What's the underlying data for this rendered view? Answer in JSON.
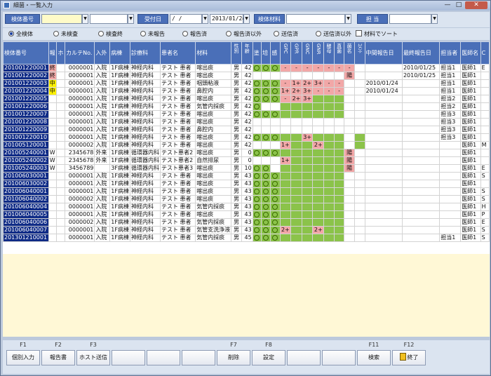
{
  "window": {
    "title": "細菌・一覧入力",
    "min": "—",
    "max": "□",
    "close": "✕"
  },
  "search": {
    "specimen_no_label": "検体番号",
    "specimen_no_value": "",
    "specimen_no_value2": "",
    "receipt_date_label": "受付日",
    "receipt_date_from": " /  / ",
    "receipt_date_to": "2013/01/24",
    "material_label": "検体材料",
    "material_value": "",
    "staff_label": "担  当",
    "staff_value": ""
  },
  "filters": {
    "options": [
      "全検体",
      "未検査",
      "検査終",
      "未報告",
      "報告済",
      "報告済以外",
      "送信済",
      "送信済以外"
    ],
    "selected": "全検体",
    "sort_checkbox_label": "材料でソート"
  },
  "table": {
    "headers": [
      "検体番号",
      "報",
      "ホ",
      "カルテNo.",
      "入外",
      "病棟",
      "診療科",
      "患者名",
      "材料",
      "性別",
      "年齢",
      "塗",
      "培",
      "感",
      "GPC",
      "GPR",
      "GNC",
      "GNR",
      "酵母",
      "真菌",
      "菌名",
      "ｺﾒﾝﾄ",
      "中間報告日",
      "最終報告日",
      "担当者",
      "医師名",
      "C"
    ],
    "rows": [
      {
        "id": "201001220001",
        "ho": "終",
        "hoc": "pk",
        "h2": "",
        "karte": "0000001",
        "io": "入院",
        "ward": "1F病棟",
        "dept": "神経内科",
        "patient": "テスト 患者",
        "material": "喀出痰",
        "sex": "男",
        "age": "42",
        "nuri": "o",
        "bai": "o",
        "kan": "o",
        "m": [
          "pk",
          "pk",
          "pk",
          "pk",
          "pk",
          "pk",
          "pk",
          "w"
        ],
        "mt": [
          "-",
          "-",
          "-",
          "-",
          "-",
          "-",
          "-",
          ""
        ],
        "mid": "",
        "fin": "2010/01/25",
        "staff": "担当1",
        "doctor": "医師1",
        "c": "E"
      },
      {
        "id": "201001220002",
        "ho": "終",
        "hoc": "pk",
        "h2": "",
        "karte": "0000001",
        "io": "入院",
        "ward": "1F病棟",
        "dept": "神経内科",
        "patient": "テスト 患者",
        "material": "喀出痰",
        "sex": "男",
        "age": "42",
        "nuri": "",
        "bai": "",
        "kan": "",
        "m": [
          "w",
          "w",
          "w",
          "w",
          "w",
          "w",
          "pk",
          "w"
        ],
        "mt": [
          "",
          "",
          "",
          "",
          "",
          "",
          "陽",
          ""
        ],
        "mid": "",
        "fin": "2010/01/25",
        "staff": "担当1",
        "doctor": "医師1",
        "c": ""
      },
      {
        "id": "201001220003",
        "ho": "中",
        "hoc": "yl",
        "h2": "",
        "karte": "0000001",
        "io": "入院",
        "ward": "1F病棟",
        "dept": "神経内科",
        "patient": "テスト 患者",
        "material": "咽頭粘液",
        "sex": "男",
        "age": "42",
        "nuri": "o",
        "bai": "o",
        "kan": "o",
        "m": [
          "pk",
          "pk",
          "pk",
          "pk",
          "pk",
          "pk",
          "w",
          "w"
        ],
        "mt": [
          "-",
          "1+",
          "2+",
          "3+",
          "-",
          "-",
          "",
          ""
        ],
        "mid": "2010/01/24",
        "fin": "",
        "staff": "担当1",
        "doctor": "医師1",
        "c": ""
      },
      {
        "id": "201001220004",
        "ho": "中",
        "hoc": "yl",
        "h2": "",
        "karte": "0000001",
        "io": "入院",
        "ward": "1F病棟",
        "dept": "神経内科",
        "patient": "テスト 患者",
        "material": "鼻腔内",
        "sex": "男",
        "age": "42",
        "nuri": "o",
        "bai": "o",
        "kan": "o",
        "m": [
          "pk",
          "pk",
          "pk",
          "pk",
          "pk",
          "pk",
          "w",
          "w"
        ],
        "mt": [
          "1+",
          "2+",
          "3+",
          "-",
          "-",
          "-",
          "",
          ""
        ],
        "mid": "2010/01/24",
        "fin": "",
        "staff": "担当1",
        "doctor": "医師1",
        "c": ""
      },
      {
        "id": "201001220005",
        "ho": "",
        "hoc": "",
        "h2": "",
        "karte": "0000001",
        "io": "入院",
        "ward": "1F病棟",
        "dept": "神経内科",
        "patient": "テスト 患者",
        "material": "喀出痰",
        "sex": "男",
        "age": "42",
        "nuri": "o",
        "bai": "o",
        "kan": "o",
        "m": [
          "pk",
          "pk",
          "pk",
          "g",
          "g",
          "g",
          "w",
          "w"
        ],
        "mt": [
          "-",
          "2+",
          "3+",
          "",
          "",
          "",
          "",
          ""
        ],
        "mid": "",
        "fin": "",
        "staff": "担当2",
        "doctor": "医師1",
        "c": ""
      },
      {
        "id": "201001220006",
        "ho": "",
        "hoc": "",
        "h2": "",
        "karte": "0000001",
        "io": "入院",
        "ward": "1F病棟",
        "dept": "神経内科",
        "patient": "テスト 患者",
        "material": "気管内採痰",
        "sex": "男",
        "age": "42",
        "nuri": "o",
        "bai": "",
        "kan": "",
        "m": [
          "g",
          "g",
          "g",
          "g",
          "g",
          "g",
          "w",
          "w"
        ],
        "mt": [
          "",
          "",
          "",
          "",
          "",
          "",
          "",
          ""
        ],
        "mid": "",
        "fin": "",
        "staff": "担当2",
        "doctor": "医師1",
        "c": ""
      },
      {
        "id": "201001220007",
        "ho": "",
        "hoc": "",
        "h2": "",
        "karte": "0000001",
        "io": "入院",
        "ward": "1F病棟",
        "dept": "神経内科",
        "patient": "テスト 患者",
        "material": "喀出痰",
        "sex": "男",
        "age": "42",
        "nuri": "o",
        "bai": "o",
        "kan": "o",
        "m": [
          "g",
          "g",
          "g",
          "g",
          "g",
          "g",
          "w",
          "w"
        ],
        "mt": [
          "",
          "",
          "",
          "",
          "",
          "",
          "",
          ""
        ],
        "mid": "",
        "fin": "",
        "staff": "担当3",
        "doctor": "医師1",
        "c": ""
      },
      {
        "id": "201001220008",
        "ho": "",
        "hoc": "",
        "h2": "",
        "karte": "0000001",
        "io": "入院",
        "ward": "1F病棟",
        "dept": "神経内科",
        "patient": "テスト 患者",
        "material": "喀出痰",
        "sex": "男",
        "age": "42",
        "nuri": "",
        "bai": "",
        "kan": "",
        "m": [
          "w",
          "w",
          "w",
          "w",
          "w",
          "w",
          "w",
          "w"
        ],
        "mt": [
          "",
          "",
          "",
          "",
          "",
          "",
          "",
          ""
        ],
        "mid": "",
        "fin": "",
        "staff": "担当3",
        "doctor": "医師1",
        "c": ""
      },
      {
        "id": "201001220009",
        "ho": "",
        "hoc": "",
        "h2": "",
        "karte": "0000001",
        "io": "入院",
        "ward": "1F病棟",
        "dept": "神経内科",
        "patient": "テスト 患者",
        "material": "鼻腔内",
        "sex": "男",
        "age": "42",
        "nuri": "",
        "bai": "",
        "kan": "",
        "m": [
          "w",
          "w",
          "w",
          "w",
          "w",
          "w",
          "w",
          "w"
        ],
        "mt": [
          "",
          "",
          "",
          "",
          "",
          "",
          "",
          ""
        ],
        "mid": "",
        "fin": "",
        "staff": "担当3",
        "doctor": "医師1",
        "c": ""
      },
      {
        "id": "201001220010",
        "ho": "",
        "hoc": "",
        "h2": "",
        "karte": "0000001",
        "io": "入院",
        "ward": "1F病棟",
        "dept": "神経内科",
        "patient": "テスト 患者",
        "material": "喀出痰",
        "sex": "男",
        "age": "42",
        "nuri": "o",
        "bai": "o",
        "kan": "o",
        "m": [
          "g",
          "g",
          "pk",
          "g",
          "g",
          "g",
          "w",
          "g"
        ],
        "mt": [
          "",
          "",
          "3+",
          "",
          "",
          "",
          "",
          ""
        ],
        "mid": "",
        "fin": "",
        "staff": "担当3",
        "doctor": "医師1",
        "c": ""
      },
      {
        "id": "201005120001",
        "ho": "",
        "hoc": "",
        "h2": "",
        "karte": "0000002",
        "io": "入院",
        "ward": "1F病棟",
        "dept": "神経内科",
        "patient": "テスト 患者",
        "material": "喀出痰",
        "sex": "男",
        "age": "42",
        "nuri": "",
        "bai": "",
        "kan": "",
        "m": [
          "pk",
          "g",
          "g",
          "pk",
          "g",
          "g",
          "w",
          "g"
        ],
        "mt": [
          "1+",
          "",
          "",
          "2+",
          "",
          "",
          "",
          ""
        ],
        "mid": "",
        "fin": "",
        "staff": "",
        "doctor": "医師1",
        "c": "M"
      },
      {
        "id": "201005240001",
        "ho": "W",
        "hoc": "",
        "h2": "",
        "karte": "2345678",
        "io": "外来",
        "ward": "1F病棟",
        "dept": "循環器内科",
        "patient": "テスト患者2",
        "material": "喀出痰",
        "sex": "男",
        "age": "0",
        "nuri": "o",
        "bai": "o",
        "kan": "o",
        "m": [
          "g",
          "g",
          "g",
          "g",
          "g",
          "g",
          "pk",
          "w"
        ],
        "mt": [
          "",
          "",
          "",
          "",
          "",
          "",
          "陽",
          ""
        ],
        "mid": "",
        "fin": "",
        "staff": "",
        "doctor": "医師1",
        "c": ""
      },
      {
        "id": "201005240002",
        "ho": "W",
        "hoc": "",
        "h2": "",
        "karte": "2345678",
        "io": "外来",
        "ward": "1F病棟",
        "dept": "循環器内科",
        "patient": "テスト患者2",
        "material": "自然排尿",
        "sex": "男",
        "age": "0",
        "nuri": "",
        "bai": "",
        "kan": "",
        "m": [
          "pk",
          "g",
          "g",
          "g",
          "g",
          "g",
          "pk",
          "w"
        ],
        "mt": [
          "1+",
          "",
          "",
          "",
          "",
          "",
          "陽",
          ""
        ],
        "mid": "",
        "fin": "",
        "staff": "",
        "doctor": "医師1",
        "c": ""
      },
      {
        "id": "201005240003",
        "ho": "W",
        "hoc": "",
        "h2": "",
        "karte": "3456789",
        "io": "",
        "ward": "3F病棟",
        "dept": "循環器内科",
        "patient": "テスト患者3",
        "material": "喀出痰",
        "sex": "男",
        "age": "10",
        "nuri": "o",
        "bai": "o",
        "kan": "",
        "m": [
          "g",
          "g",
          "g",
          "g",
          "g",
          "g",
          "pk",
          "w"
        ],
        "mt": [
          "",
          "",
          "",
          "",
          "",
          "",
          "陽",
          ""
        ],
        "mid": "",
        "fin": "",
        "staff": "",
        "doctor": "医師1",
        "c": "E"
      },
      {
        "id": "201006030001",
        "ho": "",
        "hoc": "",
        "h2": "",
        "karte": "0000001",
        "io": "入院",
        "ward": "1F病棟",
        "dept": "神経内科",
        "patient": "テスト 患者",
        "material": "喀出痰",
        "sex": "男",
        "age": "43",
        "nuri": "o",
        "bai": "o",
        "kan": "o",
        "m": [
          "g",
          "g",
          "g",
          "g",
          "g",
          "g",
          "w",
          "w"
        ],
        "mt": [
          "",
          "",
          "",
          "",
          "",
          "",
          "",
          ""
        ],
        "mid": "",
        "fin": "",
        "staff": "",
        "doctor": "医師1",
        "c": "S"
      },
      {
        "id": "201006030002",
        "ho": "",
        "hoc": "",
        "h2": "",
        "karte": "0000001",
        "io": "入院",
        "ward": "1F病棟",
        "dept": "神経内科",
        "patient": "テスト 患者",
        "material": "喀出痰",
        "sex": "男",
        "age": "43",
        "nuri": "o",
        "bai": "o",
        "kan": "o",
        "m": [
          "g",
          "g",
          "g",
          "g",
          "g",
          "g",
          "w",
          "w"
        ],
        "mt": [
          "",
          "",
          "",
          "",
          "",
          "",
          "",
          ""
        ],
        "mid": "",
        "fin": "",
        "staff": "",
        "doctor": "医師1",
        "c": ""
      },
      {
        "id": "201006040001",
        "ho": "",
        "hoc": "",
        "h2": "",
        "karte": "0000001",
        "io": "入院",
        "ward": "1F病棟",
        "dept": "神経内科",
        "patient": "テスト 患者",
        "material": "喀出痰",
        "sex": "男",
        "age": "43",
        "nuri": "o",
        "bai": "o",
        "kan": "o",
        "m": [
          "g",
          "g",
          "g",
          "g",
          "g",
          "g",
          "w",
          "w"
        ],
        "mt": [
          "",
          "",
          "",
          "",
          "",
          "",
          "",
          ""
        ],
        "mid": "",
        "fin": "",
        "staff": "",
        "doctor": "医師1",
        "c": "S"
      },
      {
        "id": "201006040002",
        "ho": "",
        "hoc": "",
        "h2": "",
        "karte": "0000002",
        "io": "入院",
        "ward": "1F病棟",
        "dept": "神経内科",
        "patient": "テスト 患者",
        "material": "喀出痰",
        "sex": "男",
        "age": "43",
        "nuri": "o",
        "bai": "o",
        "kan": "o",
        "m": [
          "g",
          "g",
          "g",
          "g",
          "g",
          "g",
          "w",
          "w"
        ],
        "mt": [
          "",
          "",
          "",
          "",
          "",
          "",
          "",
          ""
        ],
        "mid": "",
        "fin": "",
        "staff": "",
        "doctor": "医師1",
        "c": "S"
      },
      {
        "id": "201006040004",
        "ho": "",
        "hoc": "",
        "h2": "",
        "karte": "0000001",
        "io": "入院",
        "ward": "1F病棟",
        "dept": "神経内科",
        "patient": "テスト 患者",
        "material": "気管内採痰",
        "sex": "男",
        "age": "43",
        "nuri": "o",
        "bai": "o",
        "kan": "o",
        "m": [
          "g",
          "g",
          "g",
          "g",
          "g",
          "g",
          "w",
          "w"
        ],
        "mt": [
          "",
          "",
          "",
          "",
          "",
          "",
          "",
          ""
        ],
        "mid": "",
        "fin": "",
        "staff": "",
        "doctor": "医師1",
        "c": "H"
      },
      {
        "id": "201006040005",
        "ho": "",
        "hoc": "",
        "h2": "",
        "karte": "0000001",
        "io": "入院",
        "ward": "1F病棟",
        "dept": "神経内科",
        "patient": "テスト 患者",
        "material": "喀出痰",
        "sex": "男",
        "age": "43",
        "nuri": "o",
        "bai": "o",
        "kan": "o",
        "m": [
          "g",
          "g",
          "g",
          "g",
          "g",
          "g",
          "w",
          "w"
        ],
        "mt": [
          "",
          "",
          "",
          "",
          "",
          "",
          "",
          ""
        ],
        "mid": "",
        "fin": "",
        "staff": "",
        "doctor": "医師1",
        "c": "P"
      },
      {
        "id": "201006040006",
        "ho": "",
        "hoc": "",
        "h2": "",
        "karte": "0000002",
        "io": "入院",
        "ward": "1F病棟",
        "dept": "神経内科",
        "patient": "テスト 患者",
        "material": "気管内採痰",
        "sex": "男",
        "age": "43",
        "nuri": "o",
        "bai": "o",
        "kan": "o",
        "m": [
          "g",
          "g",
          "g",
          "g",
          "g",
          "g",
          "w",
          "w"
        ],
        "mt": [
          "",
          "",
          "",
          "",
          "",
          "",
          "",
          ""
        ],
        "mid": "",
        "fin": "",
        "staff": "",
        "doctor": "医師1",
        "c": "E"
      },
      {
        "id": "201006040007",
        "ho": "",
        "hoc": "",
        "h2": "",
        "karte": "0000001",
        "io": "入院",
        "ward": "1F病棟",
        "dept": "神経内科",
        "patient": "テスト 患者",
        "material": "気管支洗浄液",
        "sex": "男",
        "age": "43",
        "nuri": "o",
        "bai": "o",
        "kan": "o",
        "m": [
          "pk",
          "g",
          "g",
          "pk",
          "g",
          "g",
          "w",
          "w"
        ],
        "mt": [
          "2+",
          "",
          "",
          "2+",
          "",
          "",
          "",
          ""
        ],
        "mid": "",
        "fin": "",
        "staff": "",
        "doctor": "医師1",
        "c": "S"
      },
      {
        "id": "201301210001",
        "ho": "",
        "hoc": "",
        "h2": "",
        "karte": "0000001",
        "io": "入院",
        "ward": "1F病棟",
        "dept": "神経内科",
        "patient": "テスト 患者",
        "material": "気管内採痰",
        "sex": "男",
        "age": "45",
        "nuri": "o",
        "bai": "o",
        "kan": "o",
        "m": [
          "g",
          "g",
          "g",
          "g",
          "g",
          "g",
          "w",
          "w"
        ],
        "mt": [
          "",
          "",
          "",
          "",
          "",
          "",
          "",
          ""
        ],
        "mid": "",
        "fin": "",
        "staff": "担当1",
        "doctor": "医師1",
        "c": "S"
      }
    ]
  },
  "footer": {
    "keys": [
      "F1",
      "F2",
      "F3",
      "",
      "",
      "",
      "F7",
      "F8",
      "",
      "",
      "F11",
      "F12"
    ],
    "buttons": [
      "個別入力",
      "報告書",
      "ホスト送信",
      "",
      "",
      "",
      "削除",
      "設定",
      "",
      "",
      "検索",
      "終了"
    ]
  }
}
